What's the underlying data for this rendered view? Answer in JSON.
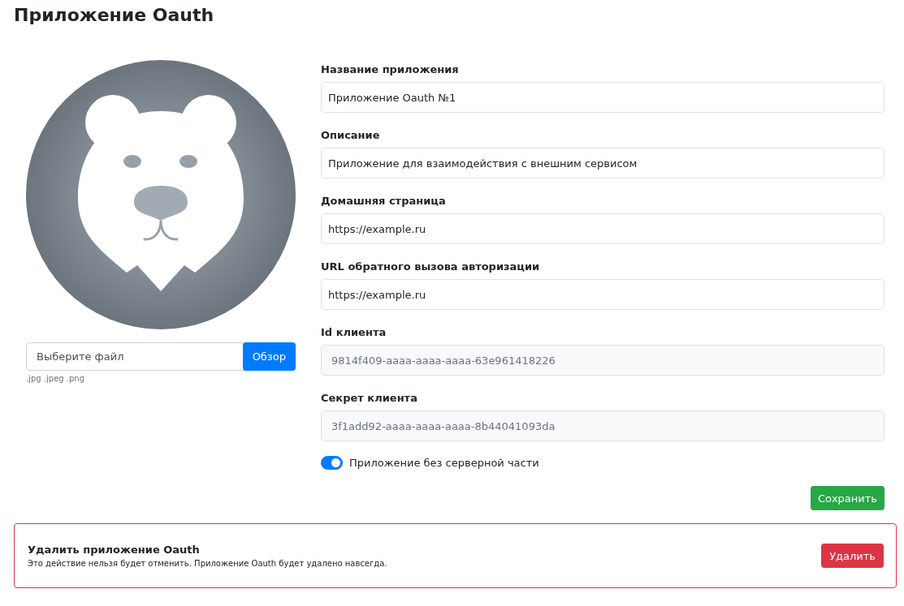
{
  "title": "Приложение Oauth",
  "avatar": {
    "file_field": {
      "placeholder": "Выберите файл"
    },
    "browse_button": "Обзор",
    "hint": ".jpg .jpeg .png"
  },
  "fields": [
    {
      "label": "Название приложения",
      "value": "Приложение Oauth №1",
      "disabled": false
    },
    {
      "label": "Описание",
      "value": "Приложение для взаимодействия с внешним сервисом",
      "disabled": false
    },
    {
      "label": "Домашняя страница",
      "value": "https://example.ru",
      "disabled": false
    },
    {
      "label": "URL обратного вызова авторизации",
      "value": "https://example.ru",
      "disabled": false
    },
    {
      "label": "Id клиента",
      "value": "9814f409-aaaa-aaaa-aaaa-63e961418226",
      "disabled": true
    },
    {
      "label": "Секрет клиента",
      "value": "3f1add92-aaaa-aaaa-aaaa-8b44041093da",
      "disabled": true
    }
  ],
  "toggle": {
    "label": "Приложение без серверной части",
    "on": true
  },
  "save_button": "Сохранить",
  "danger_zone": {
    "title": "Удалить приложение Oauth",
    "description": "Это действие нельзя будет отменить. Приложение Oauth будет удалено навсегда.",
    "button": "Удалить"
  }
}
